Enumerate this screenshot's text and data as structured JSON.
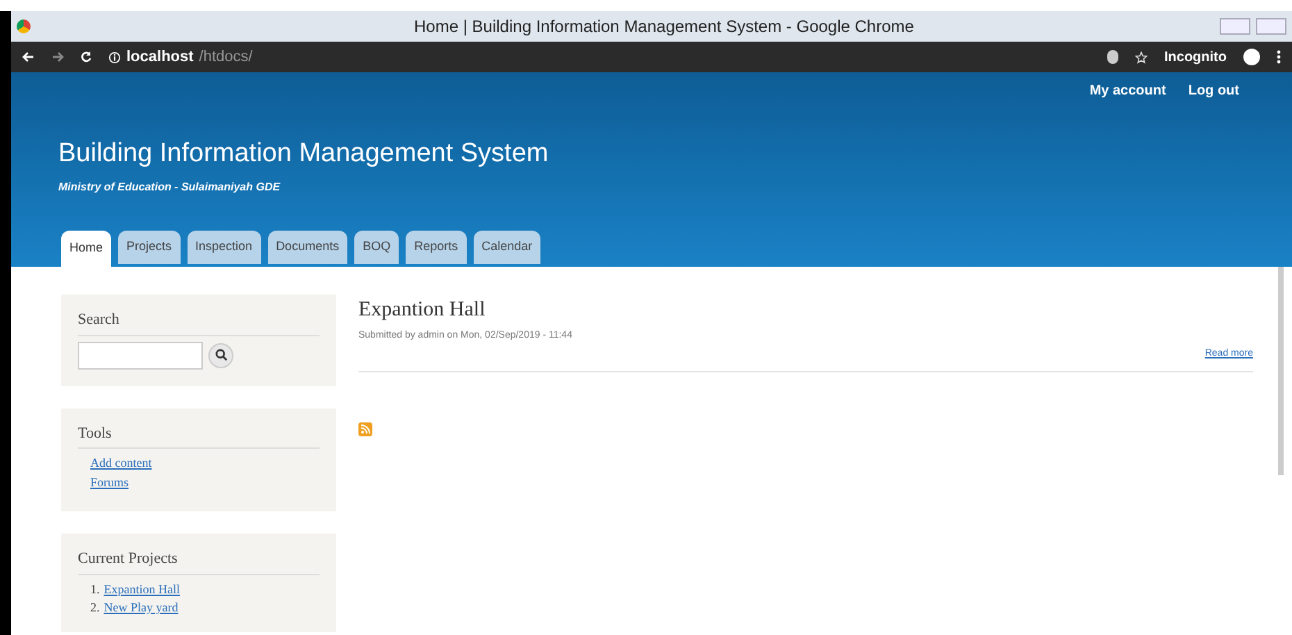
{
  "window": {
    "title": "Home | Building Information Management System - Google Chrome"
  },
  "browser": {
    "address_host": "localhost",
    "address_path": "/htdocs/",
    "profile": "Incognito"
  },
  "header": {
    "user_links": [
      "My account",
      "Log out"
    ],
    "site_name": "Building Information Management System",
    "slogan": "Ministry of Education - Sulaimaniyah GDE"
  },
  "tabs": [
    {
      "label": "Home",
      "selected": true
    },
    {
      "label": "Projects",
      "selected": false
    },
    {
      "label": "Inspection",
      "selected": false
    },
    {
      "label": "Documents",
      "selected": false
    },
    {
      "label": "BOQ",
      "selected": false
    },
    {
      "label": "Reports",
      "selected": false
    },
    {
      "label": "Calendar",
      "selected": false
    }
  ],
  "sidebar": {
    "search": {
      "title": "Search"
    },
    "tools": {
      "title": "Tools",
      "links": [
        "Add content",
        "Forums"
      ]
    },
    "current_projects": {
      "title": "Current Projects",
      "items": [
        {
          "number": "1.",
          "label": "Expantion Hall"
        },
        {
          "number": "2.",
          "label": "New Play yard"
        }
      ]
    }
  },
  "article": {
    "title": "Expantion Hall",
    "meta": "Submitted by admin on Mon, 02/Sep/2019 - 11:44",
    "read_more": "Read more"
  }
}
